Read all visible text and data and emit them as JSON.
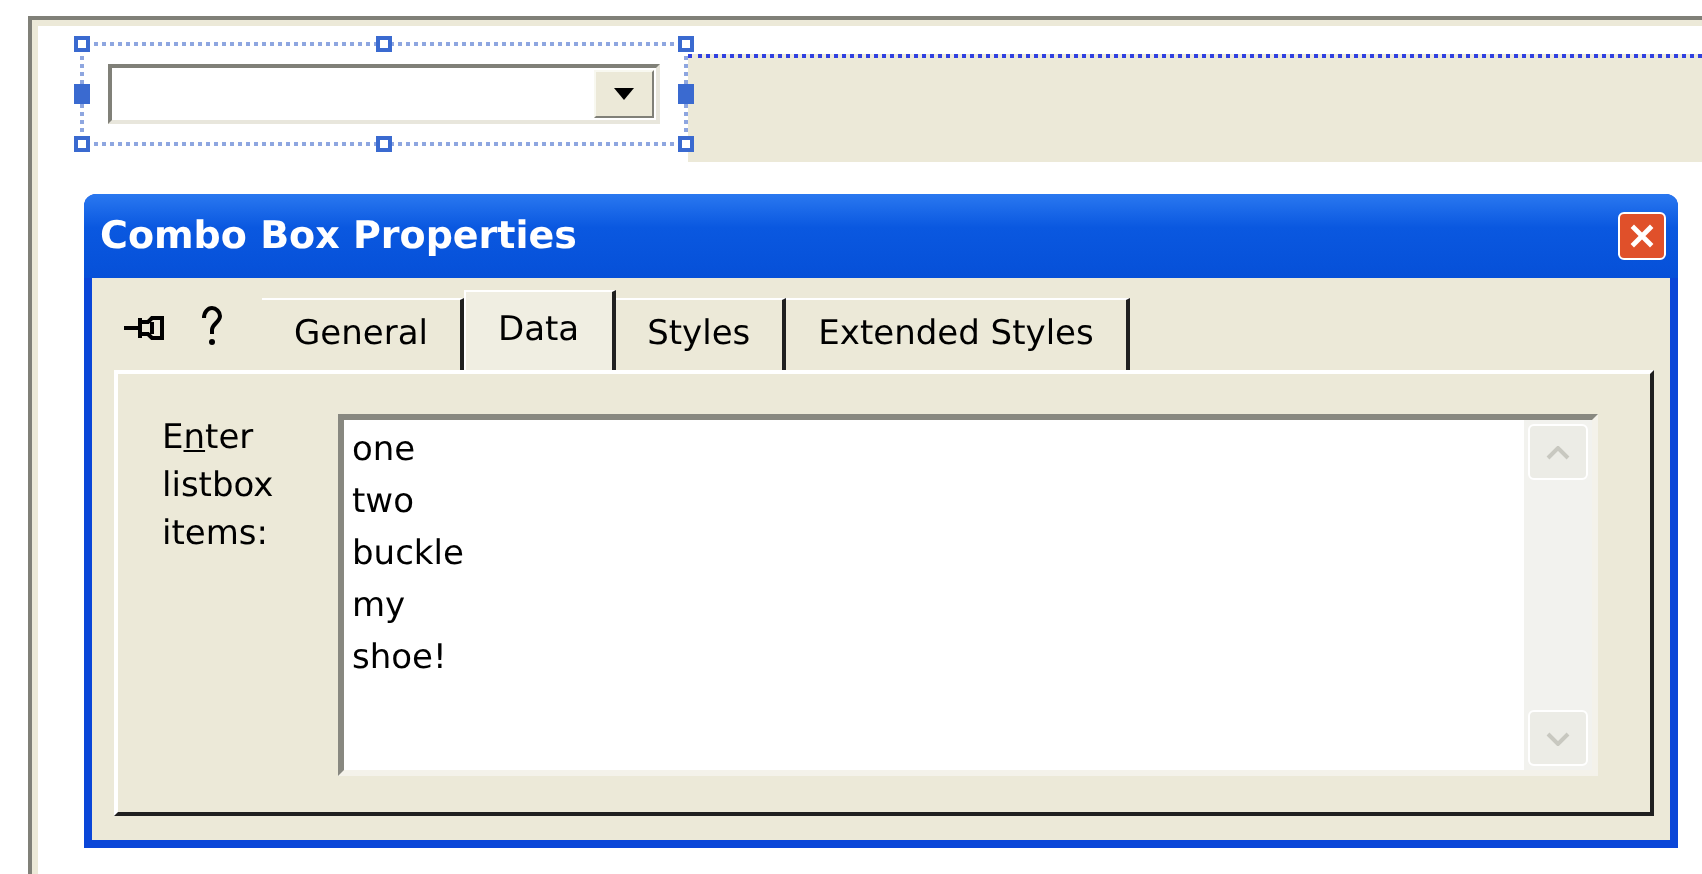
{
  "designer": {
    "combo_box": {
      "selected": true
    }
  },
  "dialog": {
    "title": "Combo Box Properties",
    "tabs": [
      {
        "label": "General",
        "selected": false
      },
      {
        "label": "Data",
        "selected": true
      },
      {
        "label": "Styles",
        "selected": false
      },
      {
        "label": "Extended Styles",
        "selected": false
      }
    ],
    "field_label": {
      "before_key": "E",
      "access_key": "n",
      "after_key": "ter listbox items:"
    },
    "items": [
      "one",
      "two",
      "buckle",
      "my",
      "shoe!"
    ]
  }
}
